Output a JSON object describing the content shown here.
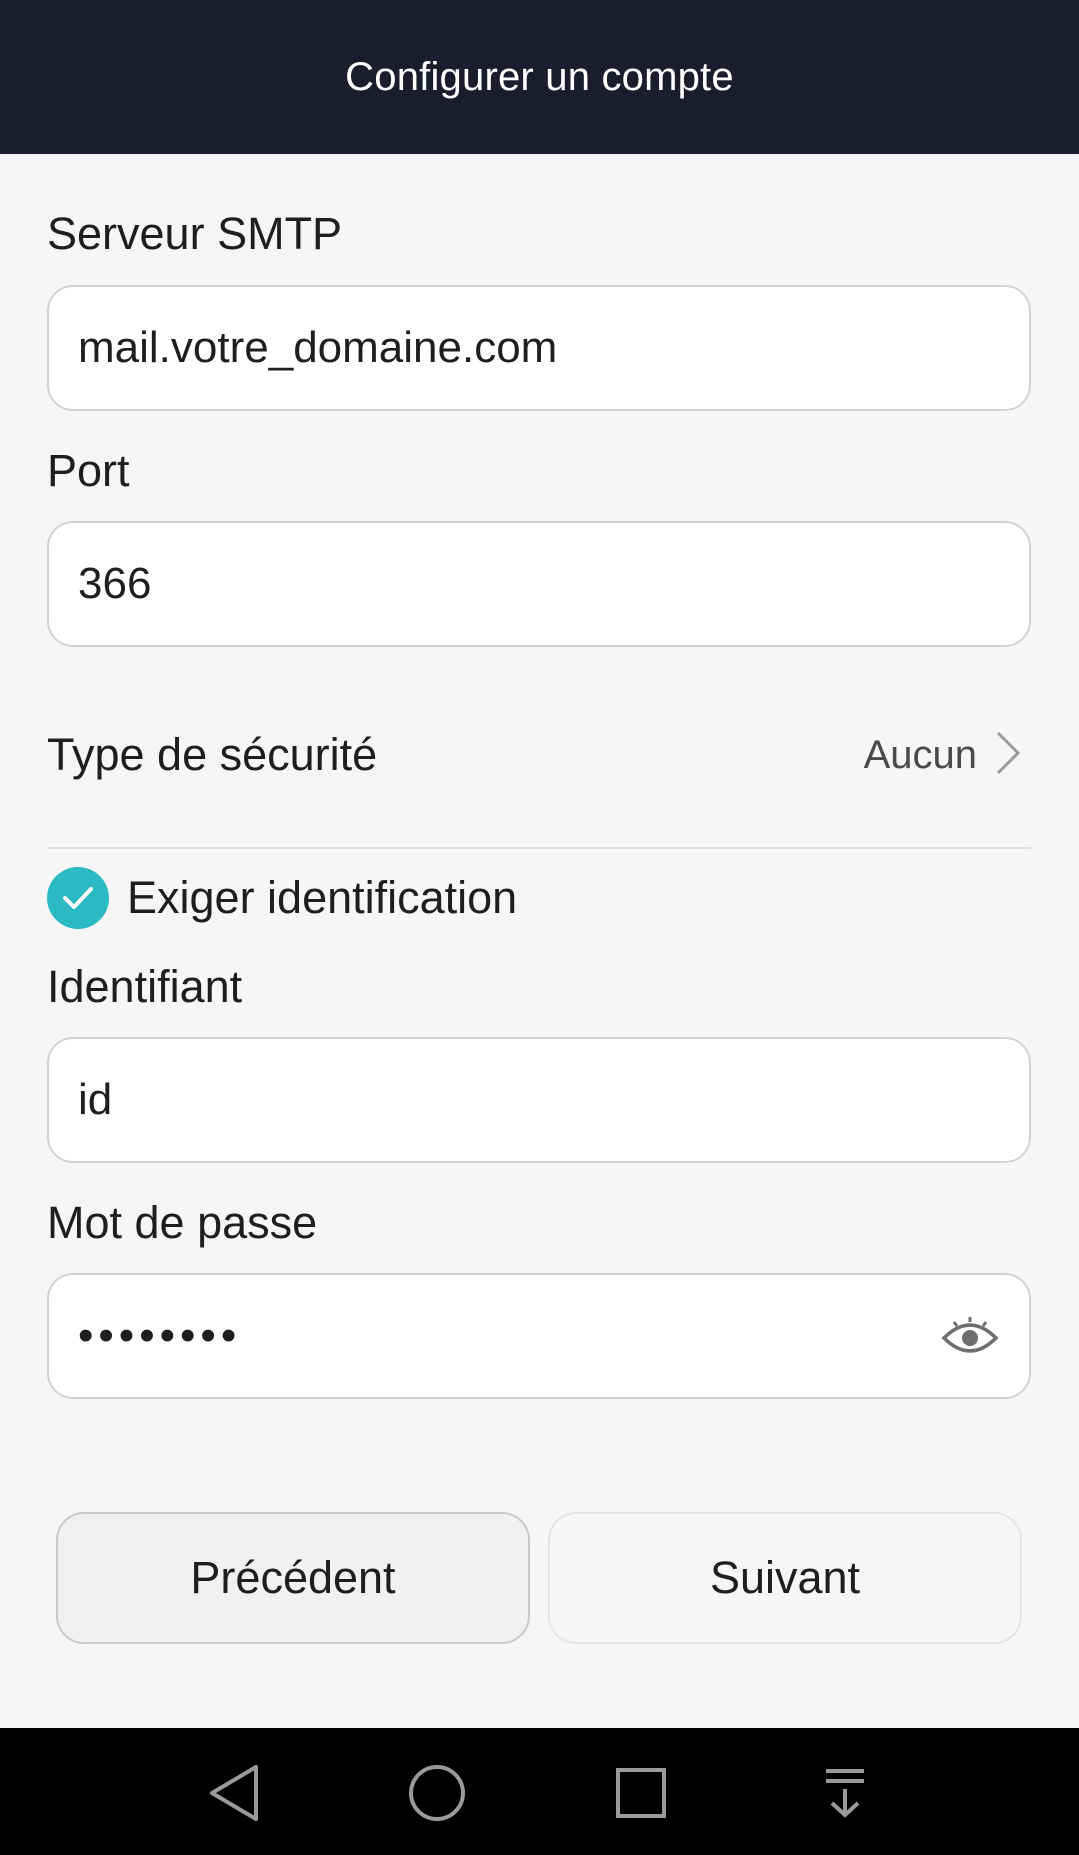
{
  "header": {
    "title": "Configurer un compte"
  },
  "form": {
    "smtp": {
      "label": "Serveur SMTP",
      "value": "mail.votre_domaine.com"
    },
    "port": {
      "label": "Port",
      "value": "366"
    },
    "security": {
      "label": "Type de sécurité",
      "value": "Aucun",
      "icon": "chevron-right-icon"
    },
    "require_auth": {
      "label": "Exiger identification",
      "checked": true,
      "color": "#2bb9c3"
    },
    "username": {
      "label": "Identifiant",
      "value": "id"
    },
    "password": {
      "label": "Mot de passe",
      "masked_value": "••••••••",
      "icon": "eye-icon"
    }
  },
  "buttons": {
    "previous": "Précédent",
    "next": "Suivant"
  },
  "navbar": {
    "icons": [
      "back-triangle-icon",
      "home-circle-icon",
      "recents-square-icon",
      "notification-pull-down-icon"
    ]
  },
  "colors": {
    "header_bg": "#1b1c2c",
    "accent": "#2bb9c3",
    "page_bg": "#f6f6f6"
  }
}
